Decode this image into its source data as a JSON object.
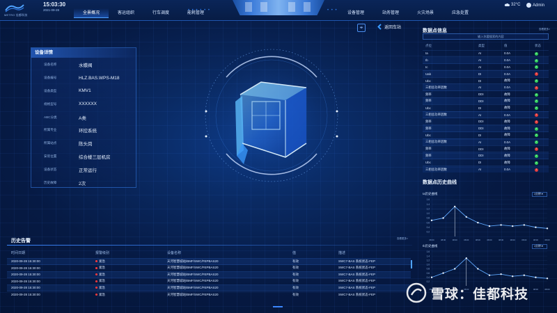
{
  "header": {
    "logo_text": "METRO 佳都科技",
    "time": "15:03:30",
    "date": "2021-09-28",
    "nav_left": [
      "全景概况",
      "客运组织",
      "行车调度",
      "能耗管理"
    ],
    "nav_right": [
      "设备管理",
      "站务管理",
      "火灾场景",
      "应急处置"
    ],
    "active_nav": "全景概况",
    "weather": "32°C",
    "user": "Admin"
  },
  "device_detail": {
    "title": "设备详情",
    "rows": [
      {
        "key": "设备名称",
        "value": "水蝶阀"
      },
      {
        "key": "设备编号",
        "value": "HLZ.BAS.WPS-M18"
      },
      {
        "key": "设备类型",
        "value": "KMV1"
      },
      {
        "key": "规格型号",
        "value": "XXXXXX"
      },
      {
        "key": "ABC分类",
        "value": "A类"
      },
      {
        "key": "所属专业",
        "value": "环控系统"
      },
      {
        "key": "所属站点",
        "value": "陈头岗"
      },
      {
        "key": "安装位置",
        "value": "综合楼三层机房"
      },
      {
        "key": "设备状态",
        "value": "正常运行"
      },
      {
        "key": "历史故障",
        "value": "2次"
      }
    ]
  },
  "center": {
    "back_label": "返回车站",
    "crosshair_icon": "crosshair-icon"
  },
  "datapoints": {
    "title": "数据点信息",
    "more": "查看更多>",
    "search_placeholder": "输入你要搜索的内容",
    "columns": [
      "点位",
      "类型",
      "值",
      "状态"
    ],
    "rows": [
      {
        "point": "Ia",
        "type": "AI",
        "value": "0.0A",
        "status": "ok"
      },
      {
        "point": "Ib",
        "type": "AI",
        "value": "0.0A",
        "status": "ok"
      },
      {
        "point": "Ic",
        "type": "AI",
        "value": "0.0A",
        "status": "ok"
      },
      {
        "point": "Uab",
        "type": "DI",
        "value": "0.0A",
        "status": "bad"
      },
      {
        "point": "Ubc",
        "type": "DI",
        "value": "故障",
        "status": "ok"
      },
      {
        "point": "三相总功率因数",
        "type": "AI",
        "value": "0.0A",
        "status": "bad"
      },
      {
        "point": "频率",
        "type": "DDI",
        "value": "故障",
        "status": "ok"
      },
      {
        "point": "频率",
        "type": "DDI",
        "value": "故障",
        "status": "ok"
      },
      {
        "point": "Ubc",
        "type": "DI",
        "value": "故障",
        "status": "ok"
      },
      {
        "point": "三相总功率因数",
        "type": "AI",
        "value": "0.0A",
        "status": "bad"
      },
      {
        "point": "频率",
        "type": "DDI",
        "value": "故障",
        "status": "bad"
      },
      {
        "point": "频率",
        "type": "DDI",
        "value": "故障",
        "status": "ok"
      },
      {
        "point": "Ubc",
        "type": "DI",
        "value": "故障",
        "status": "ok"
      },
      {
        "point": "三相总功率因数",
        "type": "AI",
        "value": "0.0A",
        "status": "ok"
      },
      {
        "point": "频率",
        "type": "DDI",
        "value": "故障",
        "status": "bad"
      },
      {
        "point": "频率",
        "type": "DDI",
        "value": "故障",
        "status": "ok"
      },
      {
        "point": "Ubc",
        "type": "DI",
        "value": "故障",
        "status": "ok"
      },
      {
        "point": "三相总功率因数",
        "type": "AI",
        "value": "0.0A",
        "status": "bad"
      }
    ]
  },
  "history_curve": {
    "title": "数据点历史曲线",
    "select_label": "1分钟 ▾"
  },
  "chart_data": [
    {
      "type": "line",
      "title": "Ia历史曲线",
      "x": [
        "08:00",
        "08:00",
        "08:00",
        "08:00",
        "08:00",
        "08:00",
        "08:00",
        "08:00",
        "08:00",
        "08:00",
        "08:00"
      ],
      "ylim": [
        0,
        1.6
      ],
      "yticks": [
        "1.6",
        "1.4",
        "1.2",
        "1.0",
        "0.8",
        "0.6",
        "0.4",
        "0.2"
      ],
      "series": [
        {
          "values": [
            0.7,
            0.8,
            1.3,
            0.85,
            0.6,
            0.45,
            0.5,
            0.45,
            0.5,
            0.4,
            0.35
          ]
        }
      ]
    },
    {
      "type": "line",
      "title": "Ib历史曲线",
      "x": [
        "08:00",
        "08:00",
        "08:00",
        "08:00",
        "08:00",
        "08:00",
        "08:00",
        "08:00",
        "08:00",
        "08:00",
        "08:00"
      ],
      "ylim": [
        0,
        1.6
      ],
      "yticks": [
        "1.6",
        "1.4",
        "1.2",
        "1.0",
        "0.8",
        "0.6",
        "0.4",
        "0.2"
      ],
      "series": [
        {
          "values": [
            0.4,
            0.6,
            0.8,
            1.3,
            0.8,
            0.5,
            0.55,
            0.45,
            0.5,
            0.4,
            0.35
          ]
        }
      ]
    }
  ],
  "alarms": {
    "title": "历史告警",
    "more": "查看更多>",
    "columns": [
      "时间日期",
      "报警级别",
      "设备名称",
      "值",
      "描述"
    ],
    "rows": [
      {
        "time": "2020-09-28 15:30:00",
        "level": "紧急",
        "device": "天河智慧城站/BMF/SWC/FEPBAS20",
        "value": "有效",
        "desc": "SWC7-BAS 系统状态-FEP"
      },
      {
        "time": "2020-09-28 15:30:00",
        "level": "紧急",
        "device": "天河智慧城站/BMF/SWC/FEPBAS20",
        "value": "有效",
        "desc": "SWC7-BAS 系统状态-FEP"
      },
      {
        "time": "2020-09-28 15:30:00",
        "level": "紧急",
        "device": "天河智慧城站/BMF/SWC/FEPBAS20",
        "value": "有效",
        "desc": "SWC7-BAS 系统状态-FEP"
      },
      {
        "time": "2020-09-28 15:30:00",
        "level": "紧急",
        "device": "天河智慧城站/BMF/SWC/FEPBAS20",
        "value": "有效",
        "desc": "SWC7-BAS 系统状态-FEP"
      },
      {
        "time": "2020-09-28 15:30:00",
        "level": "紧急",
        "device": "天河智慧城站/BMF/SWC/FEPBAS20",
        "value": "有效",
        "desc": "SWC7-BAS 系统状态-FEP"
      },
      {
        "time": "2020-09-28 15:30:00",
        "level": "紧急",
        "device": "天河智慧城站/BMF/SWC/FEPBAS20",
        "value": "有效",
        "desc": "SWC7-BAS 系统状态-FEP"
      }
    ]
  },
  "watermark": "雪球：佳都科技",
  "colors": {
    "accent": "#3b87ff",
    "ok": "#2fcf5a",
    "bad": "#e43b3b",
    "background": "#06173a"
  }
}
